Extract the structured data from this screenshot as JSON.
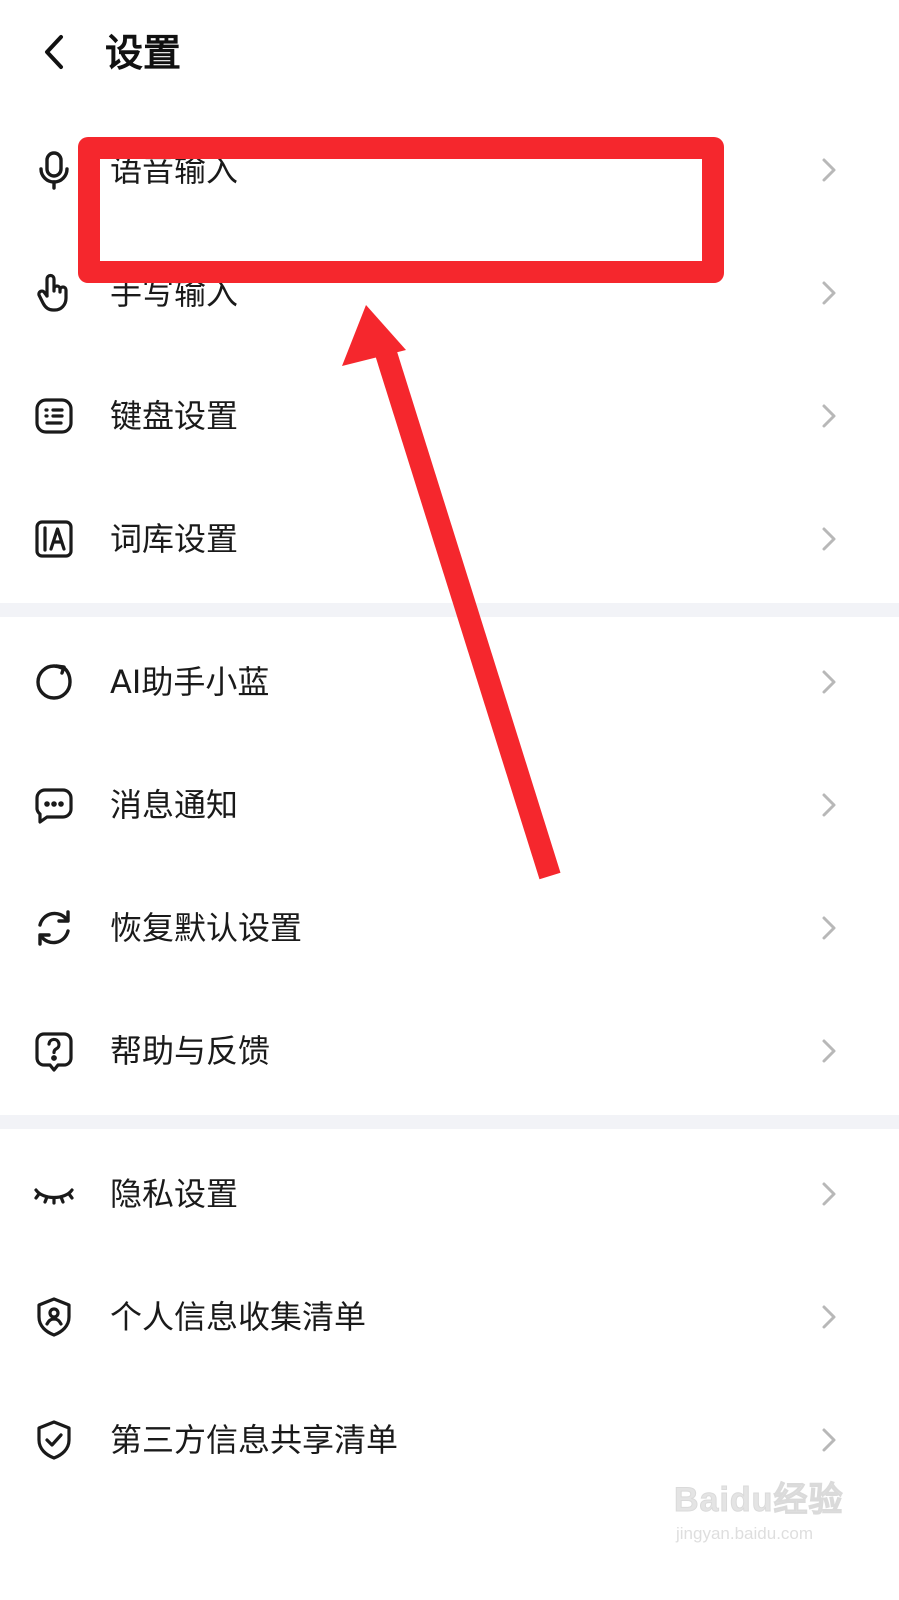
{
  "header": {
    "title": "设置",
    "back_icon": "chevron-left-icon"
  },
  "sections": [
    {
      "items": [
        {
          "label": "语音输入",
          "icon": "microphone-icon"
        },
        {
          "label": "手写输入",
          "icon": "hand-pointer-icon"
        },
        {
          "label": "键盘设置",
          "icon": "keyboard-icon"
        },
        {
          "label": "词库设置",
          "icon": "dictionary-icon"
        }
      ]
    },
    {
      "items": [
        {
          "label": "AI助手小蓝",
          "icon": "ai-assistant-icon"
        },
        {
          "label": "消息通知",
          "icon": "message-icon"
        },
        {
          "label": "恢复默认设置",
          "icon": "reset-icon"
        },
        {
          "label": "帮助与反馈",
          "icon": "help-icon"
        }
      ]
    },
    {
      "items": [
        {
          "label": "隐私设置",
          "icon": "eye-closed-icon"
        },
        {
          "label": "个人信息收集清单",
          "icon": "personal-info-shield-icon"
        },
        {
          "label": "第三方信息共享清单",
          "icon": "shield-check-icon"
        }
      ]
    }
  ],
  "annotation": {
    "color": "#f5272d"
  },
  "watermark": {
    "brand": "Baidu经验",
    "url": "jingyan.baidu.com"
  }
}
